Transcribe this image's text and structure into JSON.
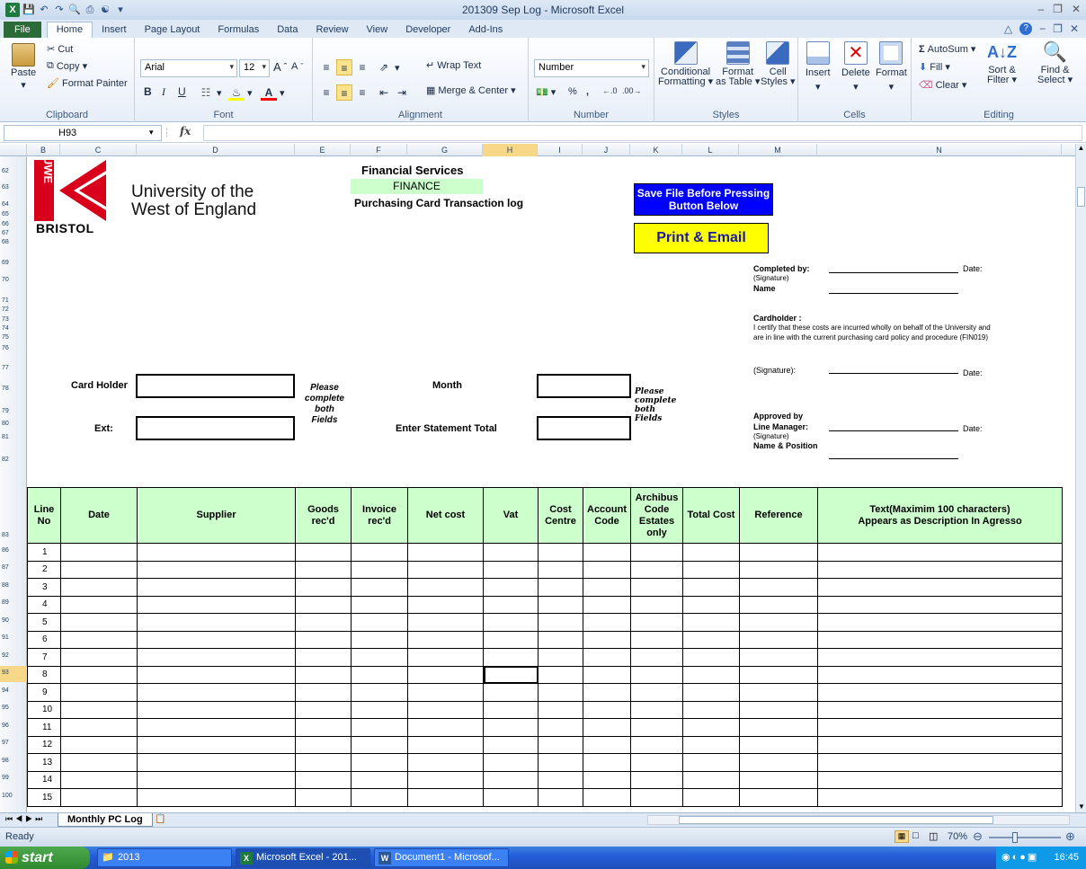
{
  "window": {
    "title": "201309 Sep Log - Microsoft Excel",
    "min": "–",
    "restore": "❐",
    "close": "✕"
  },
  "tabs": [
    "File",
    "Home",
    "Insert",
    "Page Layout",
    "Formulas",
    "Data",
    "Review",
    "View",
    "Developer",
    "Add-Ins"
  ],
  "ribbon": {
    "clipboard": {
      "label": "Clipboard",
      "paste": "Paste",
      "cut": "Cut",
      "copy": "Copy ▾",
      "format_painter": "Format Painter"
    },
    "font": {
      "label": "Font",
      "name": "Arial",
      "size": "12",
      "bold": "B",
      "italic": "I",
      "underline": "U"
    },
    "alignment": {
      "label": "Alignment",
      "wrap": "Wrap Text",
      "merge": "Merge & Center ▾"
    },
    "number": {
      "label": "Number",
      "format": "Number",
      "percent": "%",
      "comma": ","
    },
    "styles": {
      "label": "Styles",
      "conditional": "Conditional\nFormatting ▾",
      "format_table": "Format\nas Table ▾",
      "cell_styles": "Cell\nStyles ▾"
    },
    "cells": {
      "label": "Cells",
      "insert": "Insert",
      "delete": "Delete",
      "format": "Format"
    },
    "editing": {
      "label": "Editing",
      "autosum": "AutoSum ▾",
      "fill": "Fill ▾",
      "clear": "Clear ▾",
      "sort": "Sort &\nFilter ▾",
      "find": "Find &\nSelect ▾"
    }
  },
  "formula_bar": {
    "name_box": "H93",
    "fx": "fx",
    "value": ""
  },
  "columns": [
    "B",
    "C",
    "D",
    "E",
    "F",
    "G",
    "H",
    "I",
    "J",
    "K",
    "L",
    "M",
    "N"
  ],
  "rows_top": [
    "62",
    "63",
    "64",
    "65",
    "66",
    "67",
    "68",
    "69",
    "70",
    "71",
    "72",
    "73",
    "74",
    "75",
    "76",
    "77",
    "78",
    "79",
    "80",
    "81",
    "82",
    "83",
    "86",
    "87",
    "88",
    "89",
    "90",
    "91",
    "92",
    "93",
    "94",
    "95",
    "96",
    "97",
    "98",
    "99",
    "100"
  ],
  "header": {
    "org_line1": "University of the",
    "org_line2": "West of England",
    "logo_text": "BRISTOL",
    "logo_vertical": "UWE",
    "dept": "Financial Services",
    "finance": "FINANCE",
    "log_title": "Purchasing Card Transaction  log",
    "save_btn": "Save File Before Pressing Button Below",
    "print_btn": "Print & Email"
  },
  "form": {
    "card_holder": "Card Holder",
    "ext": "Ext:",
    "please1": "Please\ncomplete\nboth\nFields",
    "month": "Month",
    "statement_total": "Enter Statement Total",
    "please2": "Please\ncomplete\nboth\nFields",
    "completed_by": "Completed by:",
    "signature": "(Signature)",
    "name": "Name",
    "date": "Date:",
    "cardholder_hdr": "Cardholder :",
    "cert1": "I certify that these costs are incurred wholly on behalf of the University  and",
    "cert2": "are in line with the current purchasing card policy and procedure (FIN019)",
    "sig2": "(Signature):",
    "approved1": "Approved by",
    "approved2": "Line Manager:",
    "sig3": "(Signature)",
    "name_pos": "Name & Position"
  },
  "table": {
    "headers": [
      "Line\nNo",
      "Date",
      "Supplier",
      "Goods\nrec'd",
      "Invoice\nrec'd",
      "Net cost",
      "Vat",
      "Cost\nCentre",
      "Account\nCode",
      "Archibus\nCode\nEstates\nonly",
      "Total Cost",
      "Reference",
      "Text(Maximim 100 characters)\nAppears as Description In Agresso"
    ],
    "line_numbers": [
      "1",
      "2",
      "3",
      "4",
      "5",
      "6",
      "7",
      "8",
      "9",
      "10",
      "11",
      "12",
      "13",
      "14",
      "15"
    ]
  },
  "sheet_tab": "Monthly PC Log",
  "status": {
    "ready": "Ready",
    "zoom": "70%"
  },
  "taskbar": {
    "start": "start",
    "folder": "2013",
    "excel": "Microsoft Excel - 201...",
    "word": "Document1 - Microsof...",
    "clock": "16:45"
  },
  "colors": {
    "green_header": "#ccffcc",
    "finance_bg": "#ccffcc",
    "save_bg": "#0000ff",
    "print_bg": "#ffff00",
    "logo_red": "#d9001b"
  }
}
